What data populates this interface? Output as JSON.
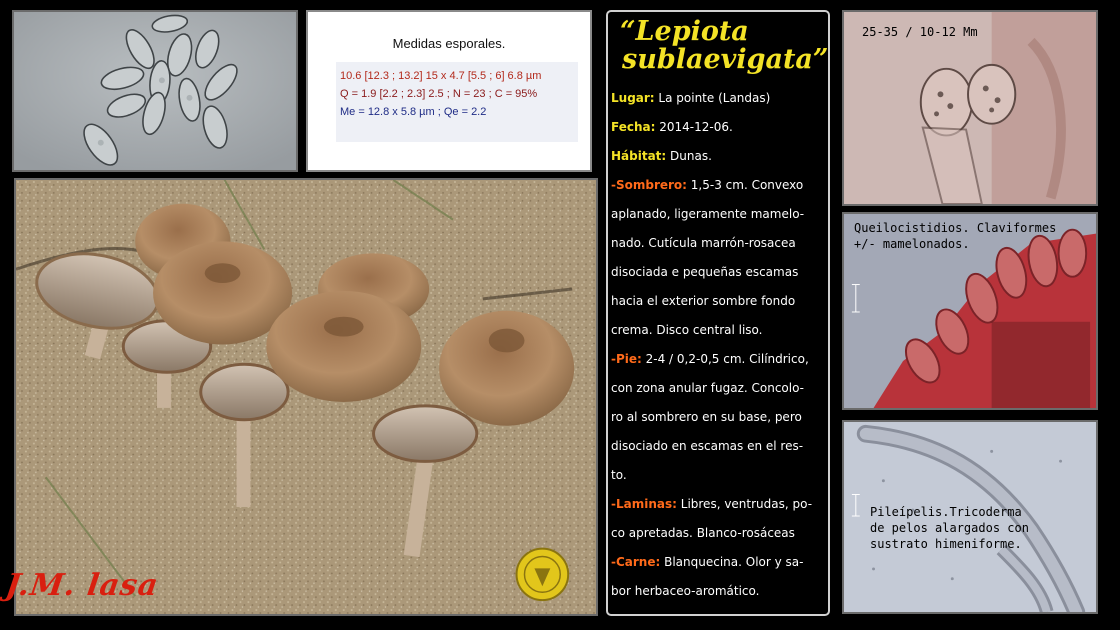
{
  "measures": {
    "title": "Medidas esporales.",
    "line1": "10.6 [12.3 ; 13.2] 15 x 4.7 [5.5 ; 6] 6.8 µm",
    "line2": "Q = 1.9 [2.2 ; 2.3] 2.5 ; N = 23 ; C = 95%",
    "line3": "Me = 12.8 x 5.8 µm ; Qe = 2.2"
  },
  "signature": "J.M. lasa",
  "description": {
    "title_line1": "“Lepiota",
    "title_line2": "sublaevigata”",
    "lugar_label": "Lugar:",
    "lugar_value": "La pointe (Landas)",
    "fecha_label": "Fecha:",
    "fecha_value": "2014-12-06.",
    "habitat_label": "Hábitat:",
    "habitat_value": "Dunas.",
    "sombrero_label": "-Sombrero:",
    "sombrero_l1": " 1,5-3 cm. Convexo",
    "sombrero_l2": "aplanado, ligeramente mamelo-",
    "sombrero_l3": "nado. Cutícula marrón-rosacea",
    "sombrero_l4": "disociada e pequeñas escamas",
    "sombrero_l5": "hacia el exterior sombre fondo",
    "sombrero_l6": "crema. Disco central liso.",
    "pie_label": "-Pie:",
    "pie_l1": " 2-4 / 0,2-0,5 cm. Cilíndrico,",
    "pie_l2": "con zona anular fugaz. Concolo-",
    "pie_l3": "ro al sombrero en su base, pero",
    "pie_l4": "disociado en escamas en el res-",
    "pie_l5": "to.",
    "laminas_label": "-Laminas:",
    "laminas_l1": " Libres, ventrudas, po-",
    "laminas_l2": "co apretadas. Blanco-rosáceas",
    "carne_label": "-Carne:",
    "carne_l1": " Blanquecina. Olor y sa-",
    "carne_l2": "bor herbaceo-aromático."
  },
  "micrographs": {
    "basidia_label": "25-35 / 10-12 Mm",
    "cheilo_line1": "Queilocistidios. Claviformes",
    "cheilo_line2": "+/- mamelonados.",
    "pileipelis_line1": "Pileípelis.Tricoderma",
    "pileipelis_line2": "de pelos alargados con",
    "pileipelis_line3": "sustrato himeniforme."
  },
  "colors": {
    "background": "#000000",
    "title": "#f4e326",
    "labels_yellow": "#f4e326",
    "labels_orange": "#ff6a1a",
    "signature": "#d91f0f"
  }
}
